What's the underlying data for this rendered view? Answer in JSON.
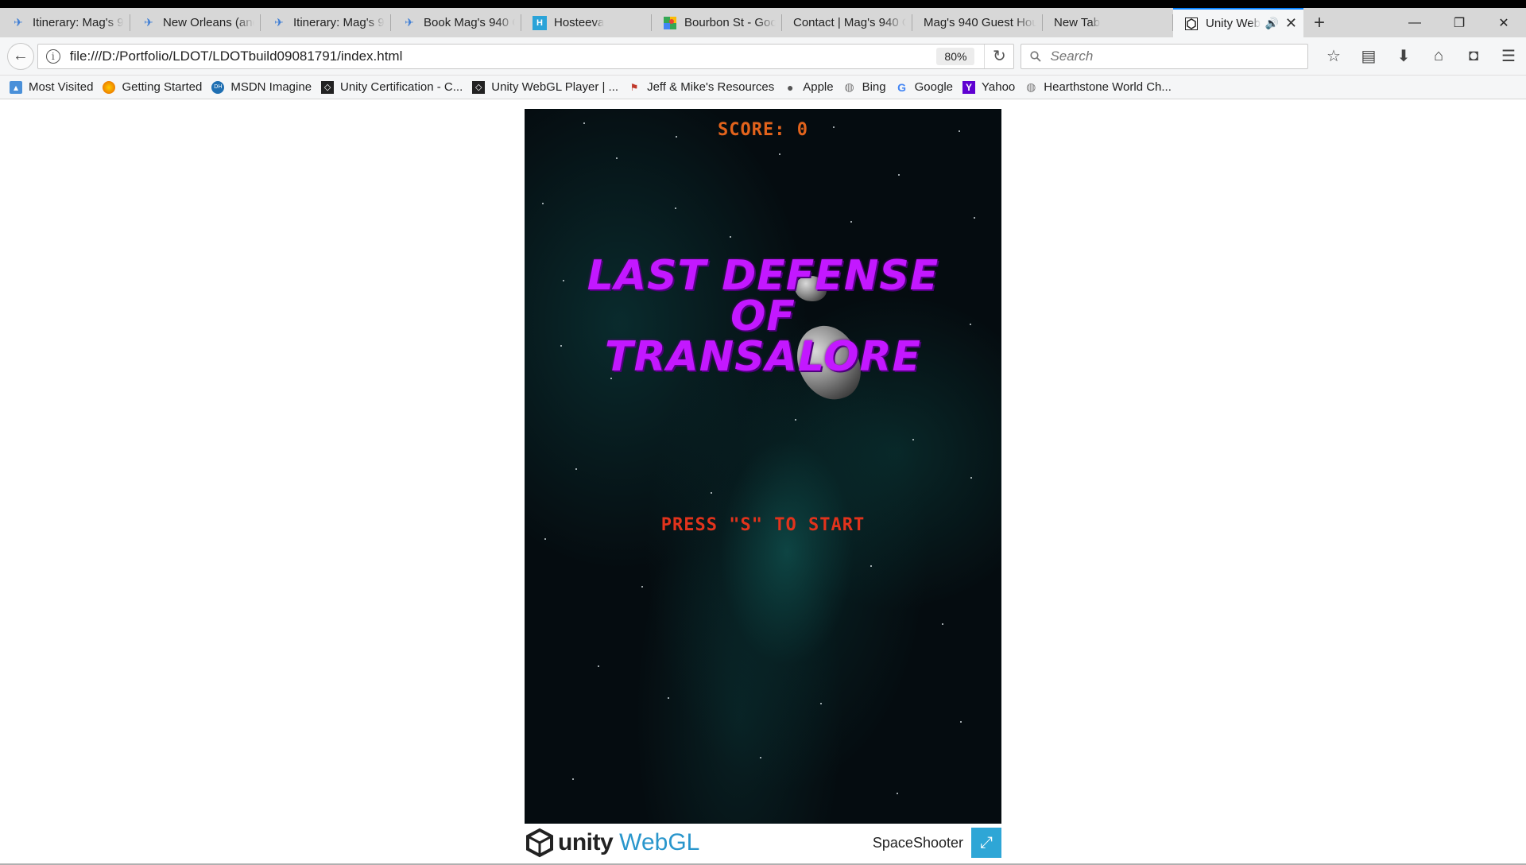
{
  "tabs": [
    {
      "title": "Itinerary: Mag's 9",
      "icon": "airplane-icon"
    },
    {
      "title": "New Orleans (and",
      "icon": "airplane-icon"
    },
    {
      "title": "Itinerary: Mag's 9",
      "icon": "airplane-icon"
    },
    {
      "title": "Book Mag's 940 G",
      "icon": "airplane-icon"
    },
    {
      "title": "Hosteeva",
      "icon": "hosteeva-icon"
    },
    {
      "title": "Bourbon St - Goo",
      "icon": "google-maps-icon"
    },
    {
      "title": "Contact | Mag's 940 G",
      "icon": "none"
    },
    {
      "title": "Mag's 940 Guest Hou",
      "icon": "none"
    },
    {
      "title": "New Tab",
      "icon": "none"
    },
    {
      "title": "Unity Web",
      "icon": "unity-icon",
      "active": true
    }
  ],
  "navbar": {
    "url": "file:///D:/Portfolio/LDOT/LDOTbuild09081791/index.html",
    "zoom": "80%",
    "search_placeholder": "Search"
  },
  "bookmarks": [
    {
      "label": "Most Visited",
      "icon": "most-visited-icon"
    },
    {
      "label": "Getting Started",
      "icon": "firefox-icon"
    },
    {
      "label": "MSDN Imagine",
      "icon": "msdn-icon"
    },
    {
      "label": "Unity Certification - C...",
      "icon": "unity-icon"
    },
    {
      "label": "Unity WebGL Player | ...",
      "icon": "unity-icon"
    },
    {
      "label": "Jeff & Mike's Resources",
      "icon": "bookmark-icon"
    },
    {
      "label": "Apple",
      "icon": "apple-icon"
    },
    {
      "label": "Bing",
      "icon": "globe-icon"
    },
    {
      "label": "Google",
      "icon": "google-icon"
    },
    {
      "label": "Yahoo",
      "icon": "yahoo-icon"
    },
    {
      "label": "Hearthstone World Ch...",
      "icon": "globe-icon"
    }
  ],
  "game": {
    "score": "SCORE: 0",
    "title_line1": "LAST DEFENSE",
    "title_line2": "OF",
    "title_line3": "TRANSALORE",
    "prompt": "PRESS \"S\" TO START"
  },
  "footer": {
    "unity_word": "unity",
    "webgl_word": "WebGL",
    "app_name": "SpaceShooter"
  },
  "colors": {
    "title": "#c318ff",
    "score": "#e2631c",
    "prompt": "#e2331c",
    "webgl_accent": "#2996cc",
    "fullscreen_button": "#2ea6d6"
  }
}
